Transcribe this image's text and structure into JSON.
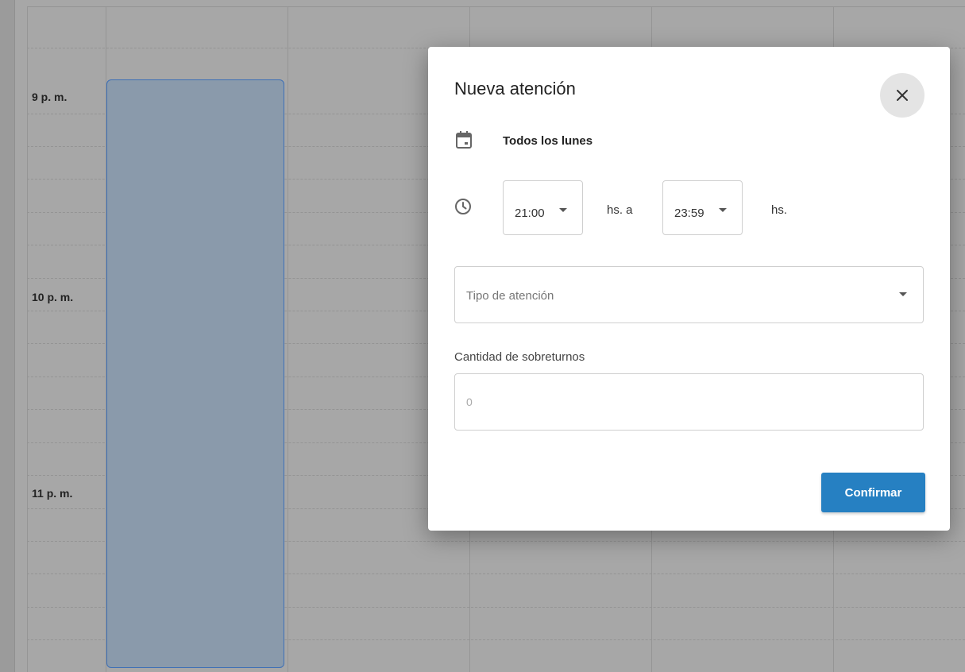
{
  "calendar": {
    "time_labels": [
      "9 p. m.",
      "10 p. m.",
      "11 p. m."
    ]
  },
  "dialog": {
    "title": "Nueva atención",
    "close_icon": "close-icon",
    "repeat_icon": "calendar-icon",
    "repeat_text": "Todos los lunes",
    "time_icon": "clock-icon",
    "start_time": "21:00",
    "between_text": "hs. a",
    "end_time": "23:59",
    "after_text": "hs.",
    "type_placeholder": "Tipo de atención",
    "quantity_label": "Cantidad de sobreturnos",
    "quantity_placeholder": "0",
    "confirm_label": "Confirmar"
  },
  "colors": {
    "accent": "#2680c2",
    "event_fill": "#8a9aab",
    "event_border": "#3d6fb6",
    "overlay": "#a7a7a7"
  }
}
